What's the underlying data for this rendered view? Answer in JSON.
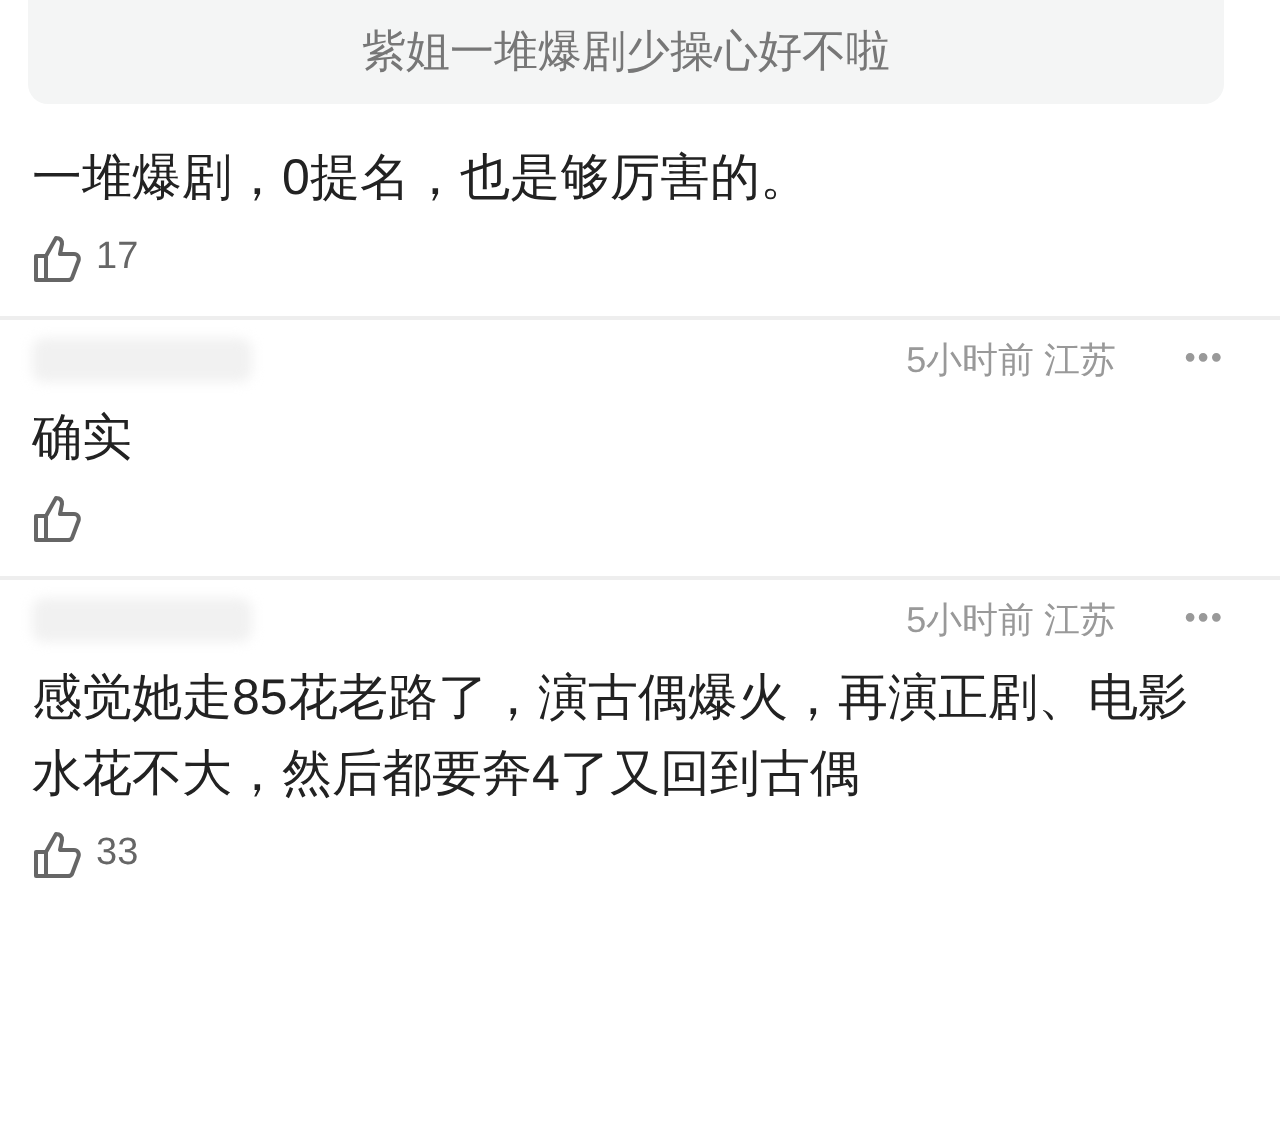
{
  "quote": {
    "text": "紫姐一堆爆剧少操心好不啦"
  },
  "comments": [
    {
      "text": "一堆爆剧，0提名，也是够厉害的。",
      "likes": "17"
    },
    {
      "meta": "5小时前 江苏",
      "more": "•••",
      "text": "确实"
    },
    {
      "meta": "5小时前 江苏",
      "more": "•••",
      "text": "感觉她走85花老路了，演古偶爆火，再演正剧、电影水花不大，然后都要奔4了又回到古偶",
      "likes": "33"
    }
  ]
}
